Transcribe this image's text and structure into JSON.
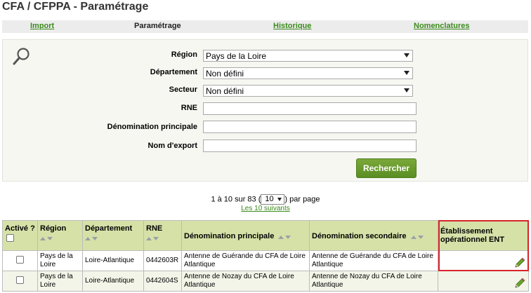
{
  "page": {
    "title": "CFA / CFPPA - Paramétrage"
  },
  "tabs": [
    {
      "label": "Import",
      "active": false
    },
    {
      "label": "Paramétrage",
      "active": true
    },
    {
      "label": "Historique",
      "active": false
    },
    {
      "label": "Nomenclatures",
      "active": false
    }
  ],
  "search": {
    "icon": "magnifier-icon",
    "fields": {
      "region": {
        "label": "Région",
        "value": "Pays de la Loire"
      },
      "departement": {
        "label": "Département",
        "value": "Non défini"
      },
      "secteur": {
        "label": "Secteur",
        "value": "Non défini"
      },
      "rne": {
        "label": "RNE",
        "value": ""
      },
      "denomination": {
        "label": "Dénomination principale",
        "value": ""
      },
      "export": {
        "label": "Nom d'export",
        "value": ""
      }
    },
    "button_label": "Rechercher"
  },
  "pagination": {
    "range_text": "1 à 10 sur 83 (",
    "page_size": "10",
    "per_page_text": ") par page",
    "next_link": "Les 10 suivants"
  },
  "table": {
    "columns": {
      "active": "Activé ?",
      "region": "Région",
      "departement": "Département",
      "rne": "RNE",
      "denom_principale": "Dénomination principale",
      "denom_secondaire": "Dénomination secondaire",
      "etab_ent": "Établissement opérationnel ENT"
    },
    "rows": [
      {
        "active": false,
        "region": "Pays de la Loire",
        "departement": "Loire-Atlantique",
        "rne": "0442603R",
        "denom_principale": "Antenne de Guérande du CFA de Loire Atlantique",
        "denom_secondaire": "Antenne de Guérande du CFA de Loire Atlantique",
        "edit_icon": "pencil-icon"
      },
      {
        "active": false,
        "region": "Pays de la Loire",
        "departement": "Loire-Atlantique",
        "rne": "0442604S",
        "denom_principale": "Antenne de Nozay du CFA de Loire Atlantique",
        "denom_secondaire": "Antenne de Nozay du CFA de Loire Atlantique",
        "edit_icon": "pencil-icon"
      }
    ]
  },
  "colors": {
    "accent_green": "#3a8a1c",
    "button_green": "#5a8e23",
    "header_bg": "#d6e1a8",
    "highlight_red": "#d9232b"
  }
}
